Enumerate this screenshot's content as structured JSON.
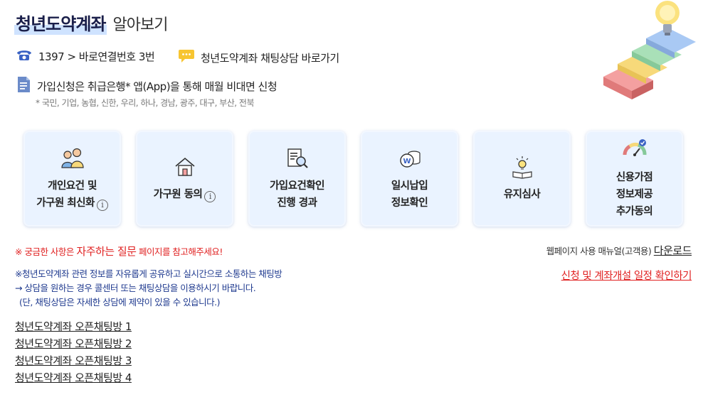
{
  "header": {
    "title_main": "청년도약계좌",
    "title_sub": "알아보기"
  },
  "contact": {
    "phone_text": "1397 > 바로연결번호 3번",
    "chat_text": "청년도약계좌 채팅상담 바로가기",
    "join_text": "가입신청은 취급은행* 앱(App)을 통해 매월 비대면 신청",
    "banks_note": "* 국민, 기업, 농협, 신한, 우리, 하나, 경남, 광주, 대구, 부산, 전북"
  },
  "cards": [
    {
      "line1": "개인요건 및",
      "line2": "가구원 최신화",
      "icon": "family-icon",
      "info": "i"
    },
    {
      "line1": "가구원 동의",
      "icon": "house-icon",
      "info": "i"
    },
    {
      "line1": "가입요건확인",
      "line2": "진행 경과",
      "icon": "document-search-icon"
    },
    {
      "line1": "일시납입",
      "line2": "정보확인",
      "icon": "coins-icon"
    },
    {
      "line1": "유지심사",
      "icon": "lightbulb-book-icon"
    },
    {
      "line1": "신용가점",
      "line2": "정보제공",
      "line3": "추가동의",
      "icon": "credit-gauge-icon"
    }
  ],
  "notes": {
    "faq_prefix": "※ 궁금한 사항은 ",
    "faq_link": "자주하는 질문",
    "faq_suffix": " 페이지를 참고해주세요!",
    "manual_prefix": "웹페이지 사용 매뉴얼(고객용) ",
    "manual_link": "다운로드",
    "schedule_link": "신청 및 계좌개설 일정 확인하기",
    "chatroom_line1": "※청년도약계좌 관련 정보를 자유롭게 공유하고 실시간으로 소통하는 채팅방",
    "chatroom_line2": "→ 상담을 원하는 경우 콜센터 또는 채팅상담을 이용하시기 바랍니다.",
    "chatroom_line3": "(단, 채팅상담은 자세한 상담에 제약이 있을 수 있습니다.)"
  },
  "open_rooms": [
    "청년도약계좌 오픈채팅방 1",
    "청년도약계좌 오픈채팅방 2",
    "청년도약계좌 오픈채팅방 3",
    "청년도약계좌 오픈채팅방 4"
  ],
  "colors": {
    "navy": "#1a1f4a",
    "accent_blue": "#3b63c4",
    "red": "#e02020",
    "card_bg": "#eaf3ff"
  }
}
